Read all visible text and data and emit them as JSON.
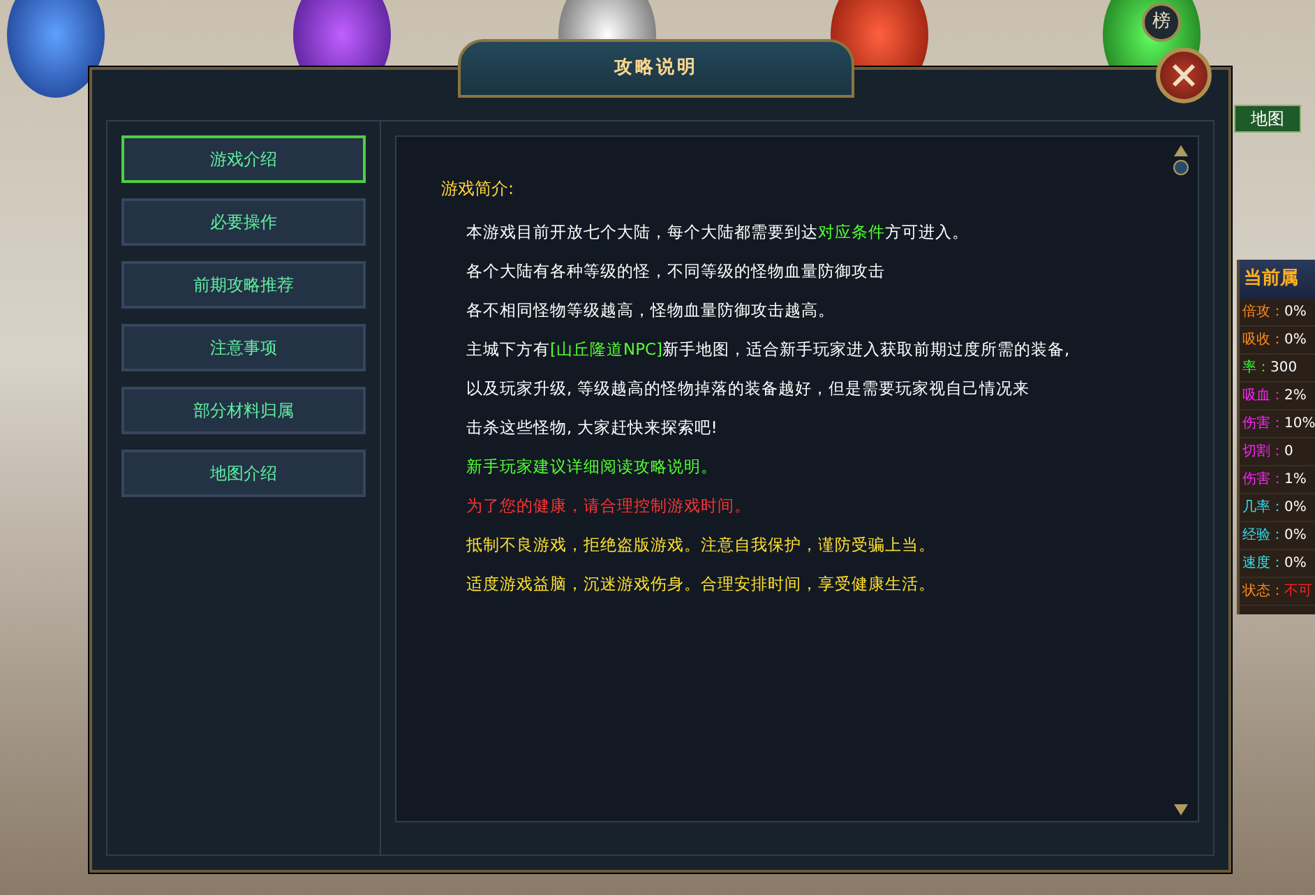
{
  "top_buttons": [
    {
      "label": "榜"
    }
  ],
  "map_button": {
    "label": "地图"
  },
  "side_panel": {
    "header": "当前属",
    "stats": [
      {
        "label": "倍攻：",
        "value": "0%",
        "color": "#ff8a1e",
        "alert": false
      },
      {
        "label": "吸收：",
        "value": "0%",
        "color": "#ff8a1e",
        "alert": false
      },
      {
        "label": "率：",
        "value": "300",
        "color": "#33ff33",
        "alert": false
      },
      {
        "label": "吸血：",
        "value": "2%",
        "color": "#ff22ff",
        "alert": false
      },
      {
        "label": "伤害：",
        "value": "10%",
        "color": "#ff22ff",
        "alert": false
      },
      {
        "label": "切割：",
        "value": "0",
        "color": "#ff22ff",
        "alert": false
      },
      {
        "label": "伤害：",
        "value": "1%",
        "color": "#ff22ff",
        "alert": false
      },
      {
        "label": "几率：",
        "value": "0%",
        "color": "#33e0f0",
        "alert": false
      },
      {
        "label": "经验：",
        "value": "0%",
        "color": "#33e0f0",
        "alert": false
      },
      {
        "label": "速度：",
        "value": "0%",
        "color": "#33e0f0",
        "alert": false
      },
      {
        "label": "状态：",
        "value": "不可",
        "color": "#ff8a1e",
        "alert": true
      }
    ]
  },
  "dialog": {
    "title": "攻略说明",
    "tabs": [
      {
        "label": "游戏介绍",
        "selected": true
      },
      {
        "label": "必要操作",
        "selected": false
      },
      {
        "label": "前期攻略推荐",
        "selected": false
      },
      {
        "label": "注意事项",
        "selected": false
      },
      {
        "label": "部分材料归属",
        "selected": false
      },
      {
        "label": "地图介绍",
        "selected": false
      }
    ],
    "content": {
      "heading": "游戏简介:",
      "lines": [
        {
          "color": "#ffffff",
          "segments": [
            {
              "text": "本游戏目前开放七个大陆，每个大陆都需要到达",
              "highlight": false
            },
            {
              "text": "对应条件",
              "highlight": true
            },
            {
              "text": "方可进入。",
              "highlight": false
            }
          ]
        },
        {
          "color": "#ffffff",
          "text": "各个大陆有各种等级的怪，不同等级的怪物血量防御攻击"
        },
        {
          "color": "#ffffff",
          "text": "各不相同怪物等级越高，怪物血量防御攻击越高。"
        },
        {
          "color": "#ffffff",
          "segments": [
            {
              "text": "主城下方有",
              "highlight": false
            },
            {
              "text": "[山丘隆道NPC]",
              "highlight": true
            },
            {
              "text": "新手地图，适合新手玩家进入获取前期过度所需的装备,",
              "highlight": false
            }
          ]
        },
        {
          "color": "#ffffff",
          "text": "以及玩家升级, 等级越高的怪物掉落的装备越好，但是需要玩家视自己情况来"
        },
        {
          "color": "#ffffff",
          "text": "击杀这些怪物, 大家赶快来探索吧!"
        },
        {
          "color": "#55ff33",
          "text": "新手玩家建议详细阅读攻略说明。"
        },
        {
          "color": "#ff3333",
          "text": "为了您的健康，请合理控制游戏时间。"
        },
        {
          "color": "#ffe030",
          "text": "抵制不良游戏，拒绝盗版游戏。注意自我保护，谨防受骗上当。"
        },
        {
          "color": "#ffe030",
          "text": "适度游戏益脑，沉迷游戏伤身。合理安排时间，享受健康生活。"
        }
      ]
    }
  }
}
